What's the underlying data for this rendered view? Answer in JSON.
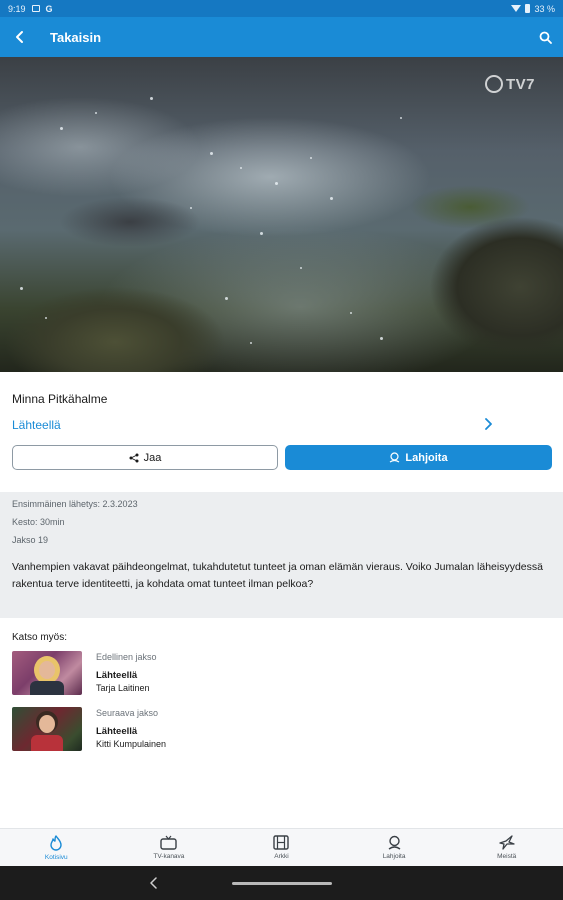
{
  "status_bar": {
    "time": "9:19",
    "google": "G",
    "battery": "33 %"
  },
  "app_bar": {
    "back_label": "Takaisin"
  },
  "hero": {
    "logo_text": "TV7"
  },
  "program": {
    "presenter": "Minna Pitkähalme",
    "series": "Lähteellä",
    "share_label": "Jaa",
    "donate_label": "Lahjoita"
  },
  "details": {
    "first_air": "Ensimmäinen lähetys: 2.3.2023",
    "duration": "Kesto: 30min",
    "episode": "Jakso 19",
    "description": "Vanhempien vakavat päihdeongelmat, tukahdutetut tunteet ja oman elämän vieraus. Voiko Jumalan läheisyydessä rakentua terve identiteetti, ja kohdata omat tunteet ilman pelkoa?"
  },
  "see_also": {
    "title": "Katso myös:",
    "items": [
      {
        "kind": "Edellinen jakso",
        "series": "Lähteellä",
        "host": "Tarja Laitinen"
      },
      {
        "kind": "Seuraava jakso",
        "series": "Lähteellä",
        "host": "Kitti Kumpulainen"
      }
    ]
  },
  "bottom_nav": {
    "items": [
      {
        "label": "Kotisivu",
        "icon": "flame-icon",
        "active": true
      },
      {
        "label": "TV-kanava",
        "icon": "tv-icon",
        "active": false
      },
      {
        "label": "Arkki",
        "icon": "film-icon",
        "active": false
      },
      {
        "label": "Lahjoita",
        "icon": "donate-icon",
        "active": false
      },
      {
        "label": "Meistä",
        "icon": "dove-icon",
        "active": false
      }
    ]
  },
  "colors": {
    "primary": "#1a8bd6",
    "status_bar": "#1578c2",
    "details_bg": "#eceef0"
  }
}
